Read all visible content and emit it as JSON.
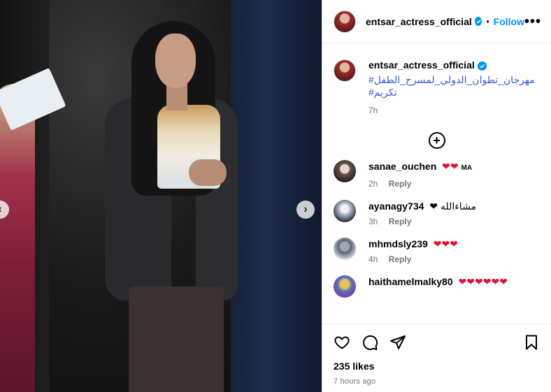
{
  "post": {
    "author": "entsar_actress_official",
    "follow_label": "Follow",
    "dot": "•",
    "more": "•••"
  },
  "caption": {
    "username": "entsar_actress_official",
    "hashtags": [
      "#مهرجان_تطوان_الدولي_لمسرح_الطفل",
      "#تكريم"
    ],
    "time": "7h"
  },
  "load_more_icon": "plus-circle-icon",
  "comments": [
    {
      "username": "sanae_ouchen",
      "text": "❤❤",
      "suffix": "MA",
      "time": "2h",
      "reply": "Reply"
    },
    {
      "username": "ayanagy734",
      "text": "❤ مشاءالله",
      "time": "3h",
      "reply": "Reply"
    },
    {
      "username": "mhmdsly239",
      "text": "❤❤❤",
      "time": "4h",
      "reply": "Reply"
    },
    {
      "username": "haithamelmalky80",
      "text": "❤❤❤❤❤❤",
      "time": "",
      "reply": ""
    }
  ],
  "footer": {
    "likes": "235 likes",
    "ago": "7 hours ago"
  },
  "colors": {
    "accent": "#0095f6",
    "heart": "#e0102f",
    "hashtag": "#3a5ad9"
  }
}
